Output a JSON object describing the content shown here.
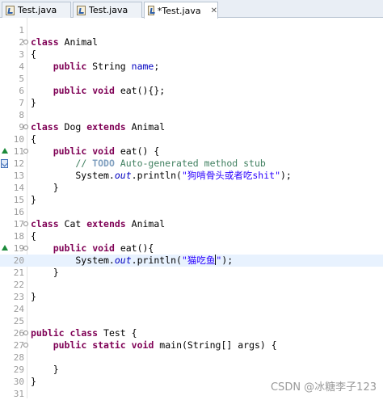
{
  "tabs": [
    {
      "label": "Test.java",
      "active": false
    },
    {
      "label": "Test.java",
      "active": false
    },
    {
      "label": "*Test.java",
      "active": true,
      "close": "✕"
    }
  ],
  "lines": [
    {
      "n": "1",
      "code": ""
    },
    {
      "n": "2",
      "code": "class Animal"
    },
    {
      "n": "3",
      "code": "{"
    },
    {
      "n": "4",
      "code": "    public String name;"
    },
    {
      "n": "5",
      "code": ""
    },
    {
      "n": "6",
      "code": "    public void eat(){};"
    },
    {
      "n": "7",
      "code": "}"
    },
    {
      "n": "8",
      "code": ""
    },
    {
      "n": "9",
      "code": "class Dog extends Animal"
    },
    {
      "n": "10",
      "code": "{"
    },
    {
      "n": "11",
      "code": "    public void eat() {",
      "marker": "override"
    },
    {
      "n": "12",
      "code": "        // TODO Auto-generated method stub",
      "marker": "todo"
    },
    {
      "n": "13",
      "code": "        System.out.println(\"狗啃骨头或者吃shit\");"
    },
    {
      "n": "14",
      "code": "    }"
    },
    {
      "n": "15",
      "code": "}"
    },
    {
      "n": "16",
      "code": ""
    },
    {
      "n": "17",
      "code": "class Cat extends Animal"
    },
    {
      "n": "18",
      "code": "{"
    },
    {
      "n": "19",
      "code": "    public void eat(){",
      "marker": "override"
    },
    {
      "n": "20",
      "code": "        System.out.println(\"猫吃鱼\");",
      "current": true
    },
    {
      "n": "21",
      "code": "    }"
    },
    {
      "n": "22",
      "code": ""
    },
    {
      "n": "23",
      "code": "}"
    },
    {
      "n": "24",
      "code": ""
    },
    {
      "n": "25",
      "code": ""
    },
    {
      "n": "26",
      "code": "public class Test {"
    },
    {
      "n": "27",
      "code": "    public static void main(String[] args) {"
    },
    {
      "n": "28",
      "code": ""
    },
    {
      "n": "29",
      "code": "    }"
    },
    {
      "n": "30",
      "code": "}"
    },
    {
      "n": "31",
      "code": ""
    }
  ],
  "watermark": "CSDN @冰糖李子123",
  "colors": {
    "keyword": "#7f0055",
    "field": "#0000c0",
    "comment": "#3f7f5f",
    "string": "#2a00ff",
    "current_line": "#e8f2fe"
  }
}
